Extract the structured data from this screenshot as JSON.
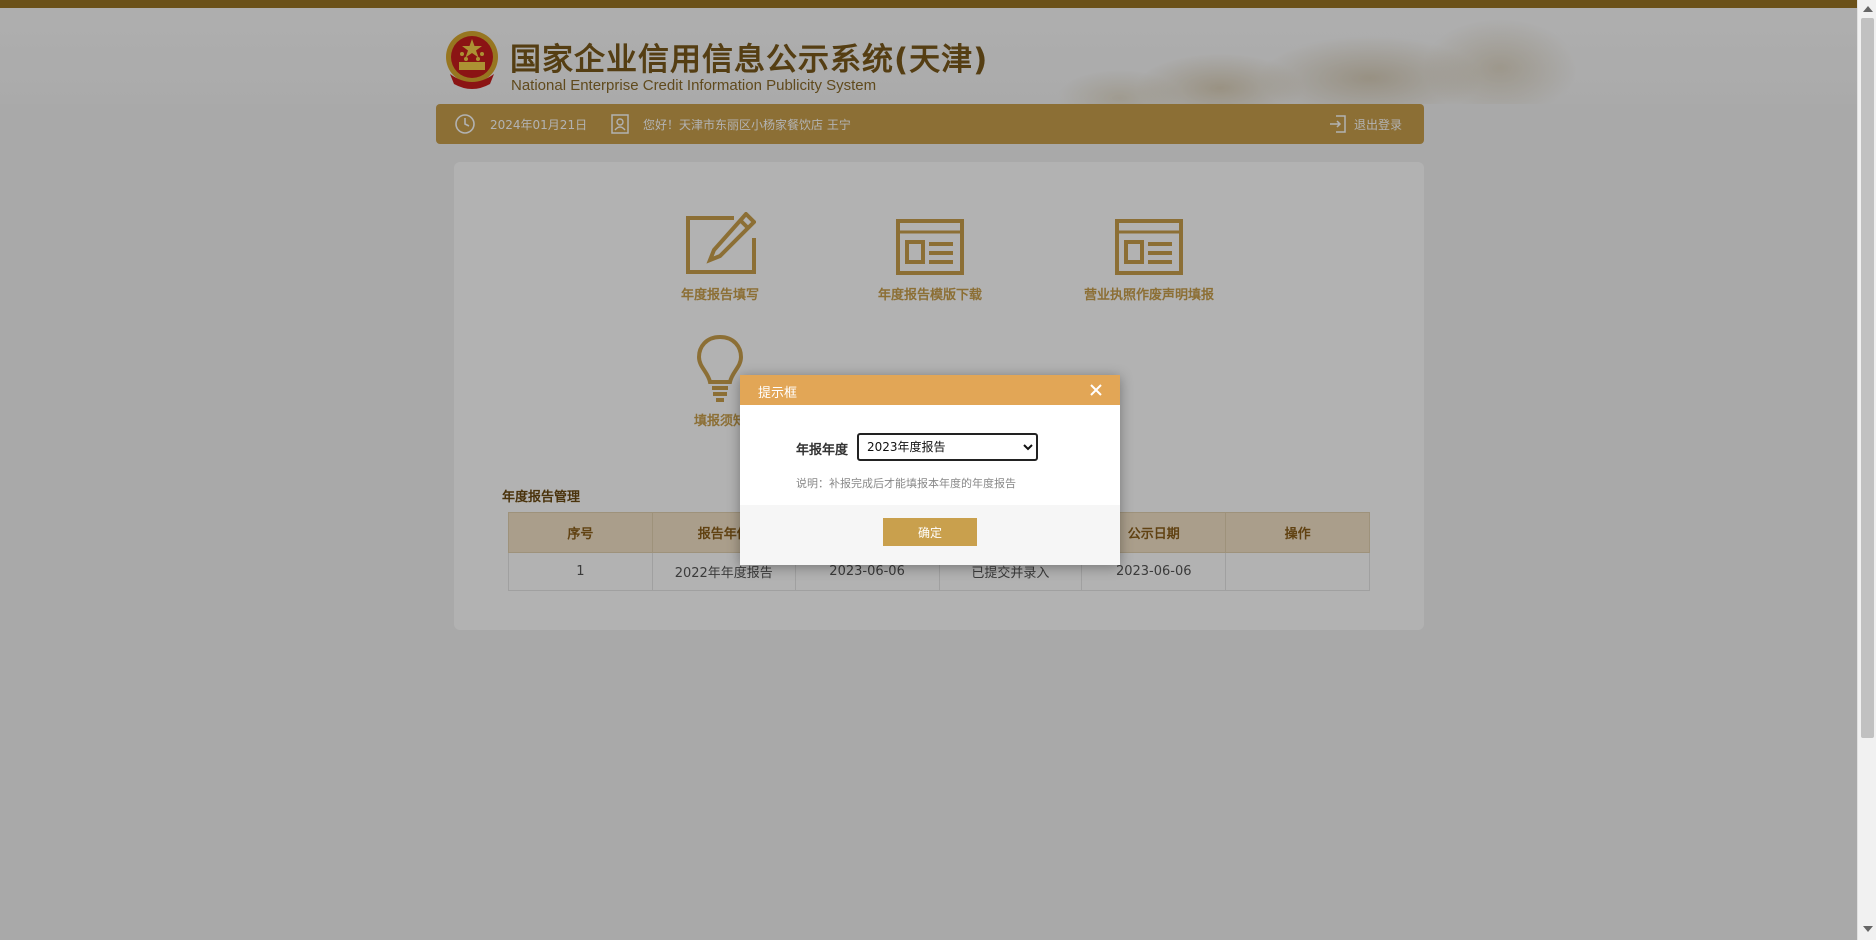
{
  "header": {
    "title": "国家企业信用信息公示系统(天津)",
    "subtitle": "National Enterprise Credit Information Publicity System"
  },
  "infobar": {
    "date": "2024年01月21日",
    "greeting": "您好！天津市东丽区小杨家餐饮店   王宁",
    "logout": "退出登录"
  },
  "functions": [
    {
      "label": "年度报告填写",
      "icon": "pencil-edit-icon"
    },
    {
      "label": "年度报告模版下载",
      "icon": "template-document-icon"
    },
    {
      "label": "营业执照作废声明填报",
      "icon": "license-document-icon"
    },
    {
      "label": "填报须知",
      "icon": "lightbulb-icon"
    }
  ],
  "report_section": {
    "title": "年度报告管理",
    "columns": [
      "序号",
      "报告年份",
      "",
      "",
      "公示日期",
      "操作"
    ],
    "rows": [
      {
        "no": "1",
        "year": "2022年年度报告",
        "submit_date": "2023-06-06",
        "status": "已提交并录入",
        "publish_date": "2023-06-06",
        "action": ""
      }
    ]
  },
  "dialog": {
    "title": "提示框",
    "year_label": "年报年度",
    "selected_year": "2023年度报告",
    "note": "说明：补报完成后才能填报本年度的年度报告",
    "confirm": "确定"
  },
  "colors": {
    "gold": "#c9a04d",
    "dialog_header": "#e2a656",
    "dark_gold": "#9a7424"
  }
}
